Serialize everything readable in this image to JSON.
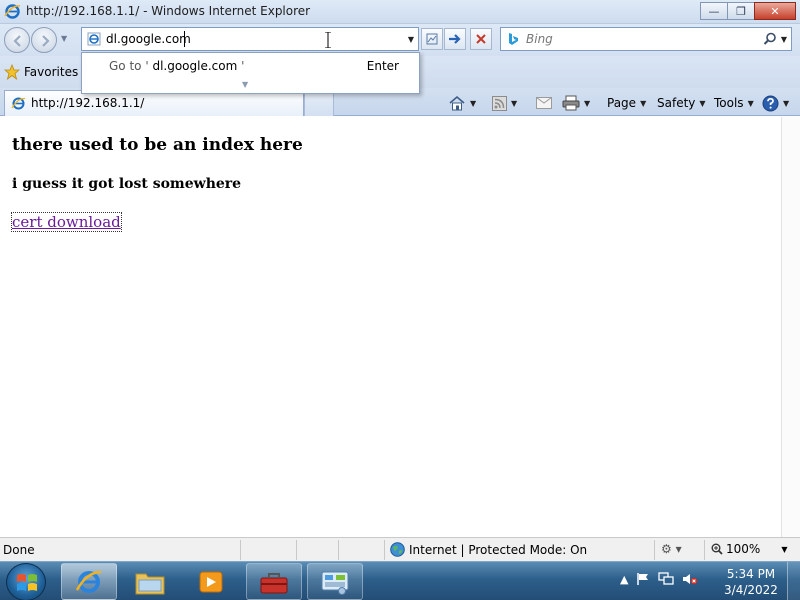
{
  "window": {
    "title": "http://192.168.1.1/ - Windows Internet Explorer",
    "buttons": {
      "minimize": "—",
      "maximize": "❐",
      "close": "✕"
    }
  },
  "address_bar": {
    "value": "dl.google.com",
    "autocomplete": {
      "prefix": "Go to '",
      "url": "dl.google.com",
      "suffix": "'",
      "action": "Enter"
    }
  },
  "search": {
    "placeholder": "Bing"
  },
  "favorites": {
    "label": "Favorites"
  },
  "tab": {
    "label": "http://192.168.1.1/"
  },
  "command_bar": {
    "page": "Page",
    "safety": "Safety",
    "tools": "Tools"
  },
  "page": {
    "heading": "there used to be an index here",
    "subheading": "i guess it got lost somewhere",
    "link": "cert download"
  },
  "status_bar": {
    "status": "Done",
    "zone": "Internet | Protected Mode: On",
    "zoom": "100%"
  },
  "taskbar": {
    "time": "5:34 PM",
    "date": "3/4/2022"
  },
  "colors": {
    "link_visited": "#6a1b9a",
    "taskbar": "#2c5f8b",
    "close_button": "#c7402c"
  }
}
